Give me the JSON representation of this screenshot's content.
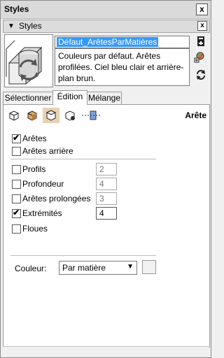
{
  "window": {
    "title": "Styles",
    "close": "x"
  },
  "section": {
    "title": "Styles",
    "close": "x"
  },
  "style": {
    "name": "Défaut_ArêtesParMatières",
    "description": "Couleurs par défaut. Arêtes profilées. Ciel bleu clair et arrière-plan brun."
  },
  "tabs": [
    "Sélectionner",
    "Édition",
    "Mélange"
  ],
  "active_tab": "Édition",
  "toolbar": {
    "icons": [
      "edge-settings-icon",
      "face-settings-icon",
      "background-settings-icon",
      "watermark-settings-icon",
      "modeling-settings-icon"
    ],
    "section_label": "Arête"
  },
  "options": {
    "aretes": {
      "label": "Arêtes",
      "checked": true
    },
    "aretes_arriere": {
      "label": "Arêtes arrière",
      "checked": false
    },
    "profils": {
      "label": "Profils",
      "checked": false,
      "value": "2"
    },
    "profondeur": {
      "label": "Profondeur",
      "checked": false,
      "value": "4"
    },
    "aretes_prolongees": {
      "label": "Arêtes prolongées",
      "checked": false,
      "value": "3"
    },
    "extremites": {
      "label": "Extrémités",
      "checked": true,
      "value": "4"
    },
    "floues": {
      "label": "Floues",
      "checked": false
    }
  },
  "couleur": {
    "label": "Couleur:",
    "value": "Par matière"
  }
}
